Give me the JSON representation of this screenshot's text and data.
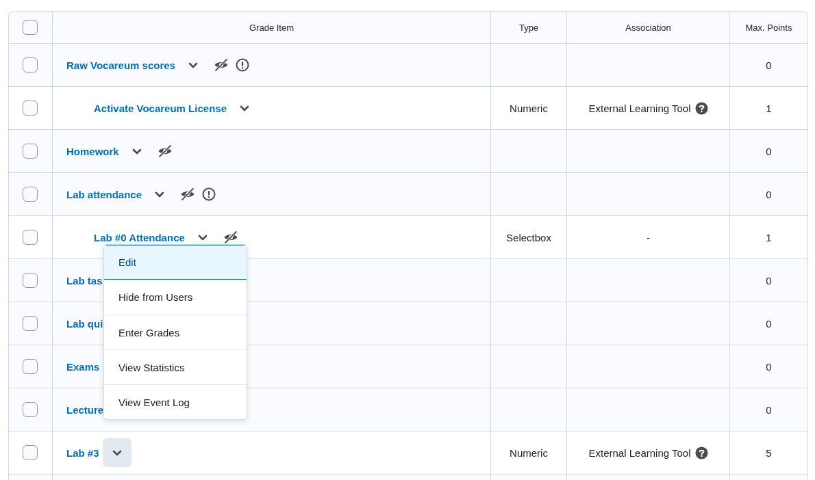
{
  "table": {
    "header": {
      "checked": false,
      "columns": [
        "Grade Item",
        "Type",
        "Association",
        "Max. Points"
      ]
    },
    "rows": [
      {
        "name": "Raw Vocareum scores",
        "kind": "category",
        "checked": false,
        "hidden": true,
        "warning": true,
        "points": "0",
        "children": [
          {
            "name": "Activate Vocareum License",
            "kind": "item",
            "checked": false,
            "hidden": false,
            "warning": false,
            "type": "Numeric",
            "association": "External Learning Tool",
            "help": true,
            "points": "1"
          }
        ]
      },
      {
        "name": "Homework",
        "kind": "category",
        "checked": false,
        "hidden": true,
        "warning": false,
        "points": "0"
      },
      {
        "name": "Lab attendance",
        "kind": "category",
        "checked": false,
        "hidden": true,
        "warning": true,
        "points": "0",
        "children": [
          {
            "name": "Lab #0 Attendance",
            "kind": "item",
            "checked": false,
            "hidden": true,
            "warning": false,
            "type": "Selectbox",
            "association": "-",
            "points": "1",
            "menu": {
              "items": [
                {
                  "label": "Edit",
                  "selected": true
                },
                {
                  "label": "Hide from Users",
                  "selected": false
                },
                {
                  "label": "Enter Grades",
                  "selected": false
                },
                {
                  "label": "View Statistics",
                  "selected": false
                },
                {
                  "label": "View Event Log",
                  "selected": false
                }
              ]
            }
          }
        ]
      },
      {
        "name": "Lab tas",
        "kind": "category",
        "checked": false,
        "points": "0"
      },
      {
        "name": "Lab qui",
        "kind": "category",
        "checked": false,
        "points": "0"
      },
      {
        "name": "Exams",
        "kind": "category",
        "checked": false,
        "points": "0"
      },
      {
        "name": "Lecture",
        "kind": "category",
        "checked": false,
        "points": "0"
      },
      {
        "name": "Lab #3",
        "kind": "item",
        "checked": false,
        "hidden": false,
        "warning": false,
        "type": "Numeric",
        "association": "External Learning Tool",
        "help": true,
        "points": "5",
        "chevron_focused": true
      }
    ]
  }
}
